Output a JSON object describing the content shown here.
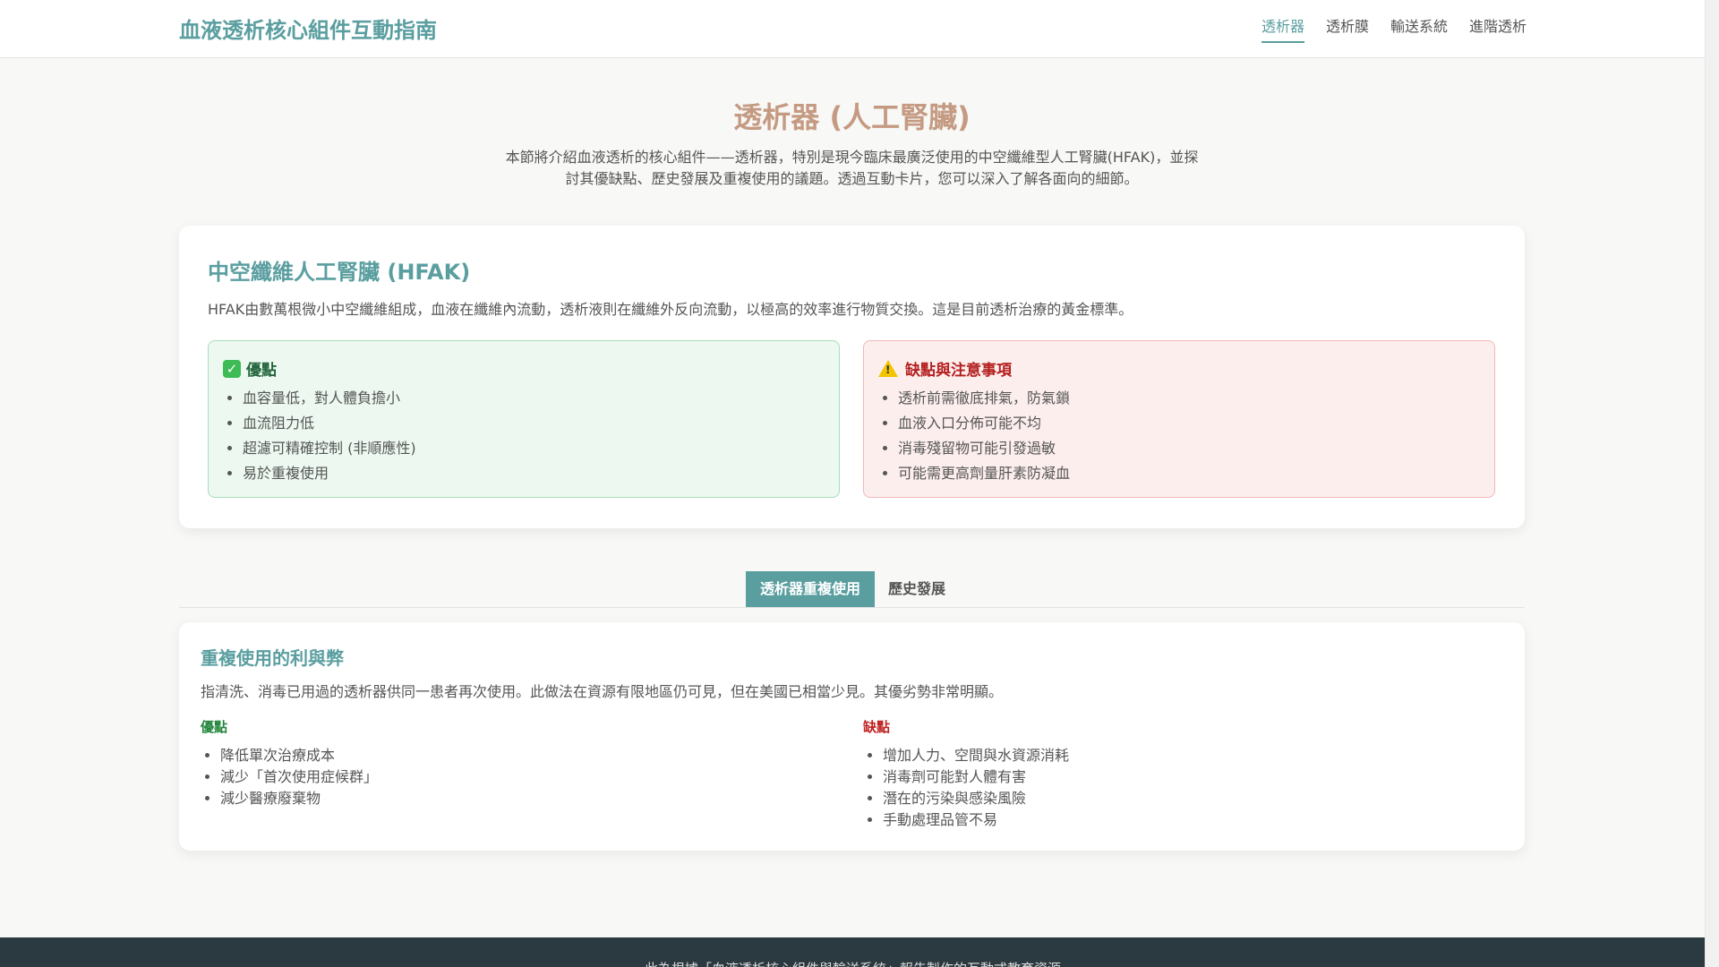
{
  "header": {
    "brand": "血液透析核心組件互動指南",
    "nav": [
      "透析器",
      "透析膜",
      "輸送系統",
      "進階透析"
    ]
  },
  "hero": {
    "title": "透析器 (人工腎臟)",
    "description": "本節將介紹血液透析的核心組件——透析器，特別是現今臨床最廣泛使用的中空纖維型人工腎臟(HFAK)，並探討其優缺點、歷史發展及重複使用的議題。透過互動卡片，您可以深入了解各面向的細節。"
  },
  "hfak": {
    "title": "中空纖維人工腎臟 (HFAK)",
    "description": "HFAK由數萬根微小中空纖維組成，血液在纖維內流動，透析液則在纖維外反向流動，以極高的效率進行物質交換。這是目前透析治療的黃金標準。",
    "pros": {
      "title": "優點",
      "items": [
        "血容量低，對人體負擔小",
        "血流阻力低",
        "超濾可精確控制 (非順應性)",
        "易於重複使用"
      ]
    },
    "cons": {
      "title": "缺點與注意事項",
      "items": [
        "透析前需徹底排氣，防氣鎖",
        "血液入口分佈可能不均",
        "消毒殘留物可能引發過敏",
        "可能需更高劑量肝素防凝血"
      ]
    }
  },
  "tabs": [
    "透析器重複使用",
    "歷史發展"
  ],
  "reuse": {
    "title": "重複使用的利與弊",
    "description": "指清洗、消毒已用過的透析器供同一患者再次使用。此做法在資源有限地區仍可見，但在美國已相當少見。其優劣勢非常明顯。",
    "pros": {
      "title": "優點",
      "items": [
        "降低單次治療成本",
        "減少「首次使用症候群」",
        "減少醫療廢棄物"
      ]
    },
    "cons": {
      "title": "缺點",
      "items": [
        "增加人力、空間與水資源消耗",
        "消毒劑可能對人體有害",
        "潛在的污染與感染風險",
        "手動處理品管不易"
      ]
    }
  },
  "footer": {
    "text": "此為根據「血液透析核心組件與輸送系統」報告製作的互動式教育資源"
  }
}
